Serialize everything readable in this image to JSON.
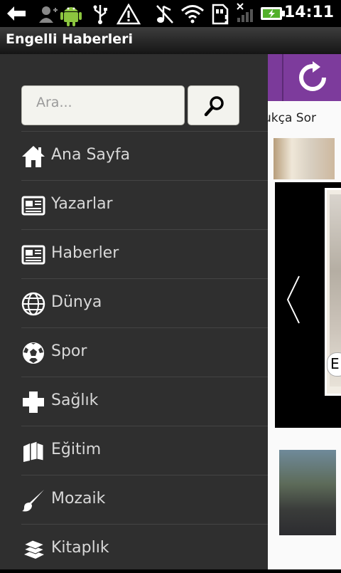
{
  "status_bar": {
    "time": "14:11"
  },
  "app": {
    "title": "Engelli Haberleri"
  },
  "search": {
    "placeholder": "Ara..."
  },
  "menu": [
    {
      "label": "Ana Sayfa",
      "icon": "home-icon"
    },
    {
      "label": "Yazarlar",
      "icon": "newspaper-icon"
    },
    {
      "label": "Haberler",
      "icon": "newspaper-icon"
    },
    {
      "label": "Dünya",
      "icon": "globe-icon"
    },
    {
      "label": "Spor",
      "icon": "soccer-ball-icon"
    },
    {
      "label": "Sağlık",
      "icon": "plus-cross-icon"
    },
    {
      "label": "Eğitim",
      "icon": "books-icon"
    },
    {
      "label": "Mozaik",
      "icon": "paintbrush-icon"
    },
    {
      "label": "Kitaplık",
      "icon": "book-stack-icon"
    }
  ],
  "background_page": {
    "link_fragment": "ukça Sor",
    "slider_caption_fragment": "E"
  },
  "colors": {
    "accent": "#7b3a9a",
    "drawer": "#2f2f2f"
  }
}
